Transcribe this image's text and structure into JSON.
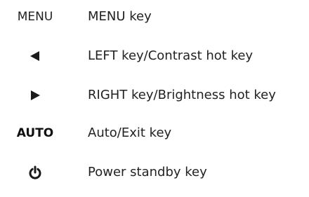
{
  "keys": [
    {
      "symbol_type": "text",
      "symbol": "MENU",
      "description": "MENU key"
    },
    {
      "symbol_type": "icon",
      "icon": "left-triangle-icon",
      "description": "LEFT key/Contrast hot key"
    },
    {
      "symbol_type": "icon",
      "icon": "right-triangle-icon",
      "description": "RIGHT key/Brightness hot key"
    },
    {
      "symbol_type": "text",
      "symbol": "AUTO",
      "description": "Auto/Exit key"
    },
    {
      "symbol_type": "icon",
      "icon": "power-icon",
      "description": "Power standby key"
    }
  ],
  "colors": {
    "text": "#222222",
    "icon": "#1a1a1a",
    "background": "#ffffff"
  }
}
